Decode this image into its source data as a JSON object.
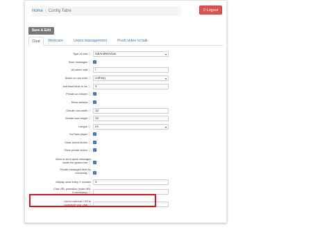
{
  "breadcrumb": {
    "home": "Home",
    "separator": "/",
    "current": "Config Table"
  },
  "logout_label": "Logout",
  "save_edit_label": "Save & Edit",
  "tabs": [
    {
      "label": "Chat",
      "active": true
    },
    {
      "label": "Webcam",
      "active": false
    },
    {
      "label": "Users management",
      "active": false
    },
    {
      "label": "Push video to talk",
      "active": false
    }
  ],
  "fields": [
    {
      "label": "Type of chat",
      "type": "select",
      "value": "tabAndWindow"
    },
    {
      "label": "Save messages",
      "type": "checkbox",
      "checked": true
    },
    {
      "label": "Url where edit",
      "type": "text",
      "value": "/"
    },
    {
      "label": "Action on rule exist",
      "type": "select",
      "value": "nothing"
    },
    {
      "label": "Anti flood timer in ms",
      "type": "text",
      "value": "0"
    },
    {
      "label": "Private on rollover",
      "type": "checkbox",
      "checked": true
    },
    {
      "label": "Show smileys",
      "type": "checkbox",
      "checked": true
    },
    {
      "label": "Gender icon width",
      "type": "text",
      "value": "32"
    },
    {
      "label": "Gender icon height",
      "type": "text",
      "value": "32"
    },
    {
      "label": "Langue",
      "type": "select",
      "value": "en"
    },
    {
      "label": "YouTube player",
      "type": "checkbox",
      "checked": true
    },
    {
      "label": "Show rooms button",
      "type": "checkbox",
      "checked": true
    },
    {
      "label": "Show private button",
      "type": "checkbox",
      "checked": true
    },
    {
      "label": "Allow to send quick messages inside the global chat",
      "type": "checkbox",
      "checked": true
    },
    {
      "label": "Private messages seen by everybody",
      "type": "checkbox",
      "checked": true
    },
    {
      "label": "Display news every X minutes",
      "type": "text",
      "value": "3"
    },
    {
      "label": "Chat URL protection (enter URL if necessary)",
      "type": "text",
      "value": ""
    },
    {
      "label": "Link to external CSS to customize your chat",
      "type": "text",
      "value": ""
    }
  ],
  "icons": {
    "logout": "power-icon",
    "help": "question-circle-icon",
    "check": "checkmark-icon",
    "caret": "caret-down-icon"
  },
  "colors": {
    "accent": "#337ab7",
    "danger": "#d9534f",
    "highlight": "#d9141c",
    "checkbox": "#2f6fb7"
  }
}
